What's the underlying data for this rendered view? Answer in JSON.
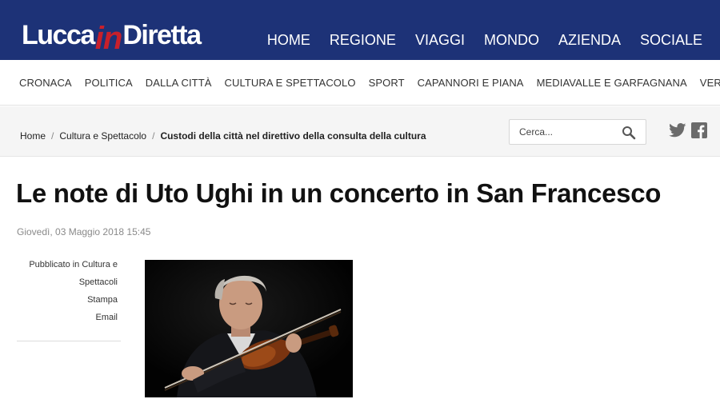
{
  "site": {
    "logo_part1": "Lucca",
    "logo_part2": "in",
    "logo_part3": "Diretta",
    "brand_color": "#1d3277",
    "accent_color": "#c8202b"
  },
  "main_nav": [
    "HOME",
    "REGIONE",
    "VIAGGI",
    "MONDO",
    "AZIENDA",
    "SOCIALE"
  ],
  "sub_nav": [
    "CRONACA",
    "POLITICA",
    "DALLA CITTÀ",
    "CULTURA E SPETTACOLO",
    "SPORT",
    "CAPANNORI E PIANA",
    "MEDIAVALLE E GARFAGNANA",
    "VERSILIA"
  ],
  "breadcrumb": {
    "home": "Home",
    "sep": "/",
    "section": "Cultura e Spettacolo",
    "current": "Custodi della città nel direttivo della consulta della cultura"
  },
  "search": {
    "placeholder": "Cerca...",
    "icon": "search-icon"
  },
  "social": {
    "twitter": "twitter-icon",
    "facebook": "facebook-icon"
  },
  "article": {
    "title": "Le note di Uto Ughi in un concerto in San Francesco",
    "date": "Giovedì, 03 Maggio 2018 15:45",
    "published_line1": "Pubblicato in Cultura e",
    "published_line2": "Spettacoli",
    "print_label": "Stampa",
    "email_label": "Email"
  }
}
